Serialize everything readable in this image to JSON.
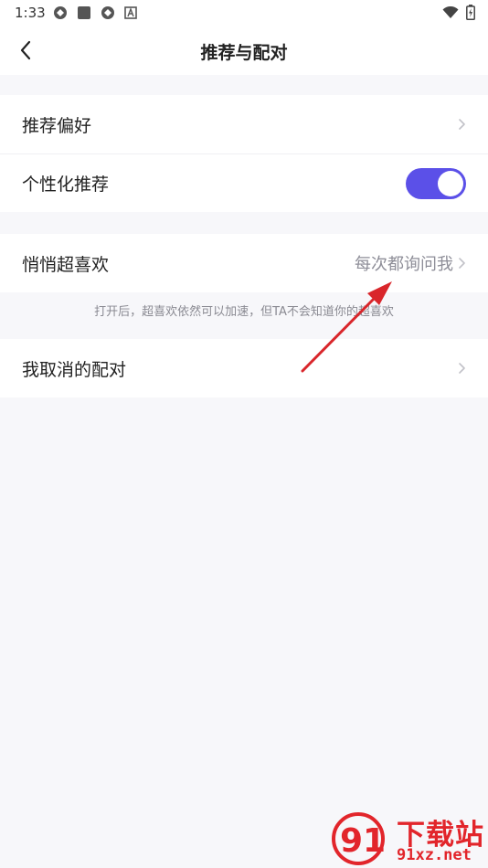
{
  "status_bar": {
    "time": "1:33",
    "icons_left": [
      "sync-icon",
      "app-square-icon",
      "sync-icon",
      "font-a-icon"
    ],
    "icons_right": [
      "wifi-icon",
      "battery-charging-icon"
    ]
  },
  "nav": {
    "title": "推荐与配对",
    "back_icon": "chevron-left-icon"
  },
  "sections": {
    "recommend_pref": {
      "label": "推荐偏好"
    },
    "personalized": {
      "label": "个性化推荐",
      "toggle_on": true
    },
    "secret_superlike": {
      "label": "悄悄超喜欢",
      "value": "每次都询问我"
    },
    "secret_superlike_note": "打开后，超喜欢依然可以加速，但TA不会知道你的超喜欢",
    "cancelled_matches": {
      "label": "我取消的配对"
    }
  },
  "colors": {
    "accent": "#5b50e8",
    "background": "#f7f7fa",
    "annotation_arrow": "#d9262b"
  },
  "watermark": {
    "title": "下载站",
    "url": "91xz.net"
  }
}
